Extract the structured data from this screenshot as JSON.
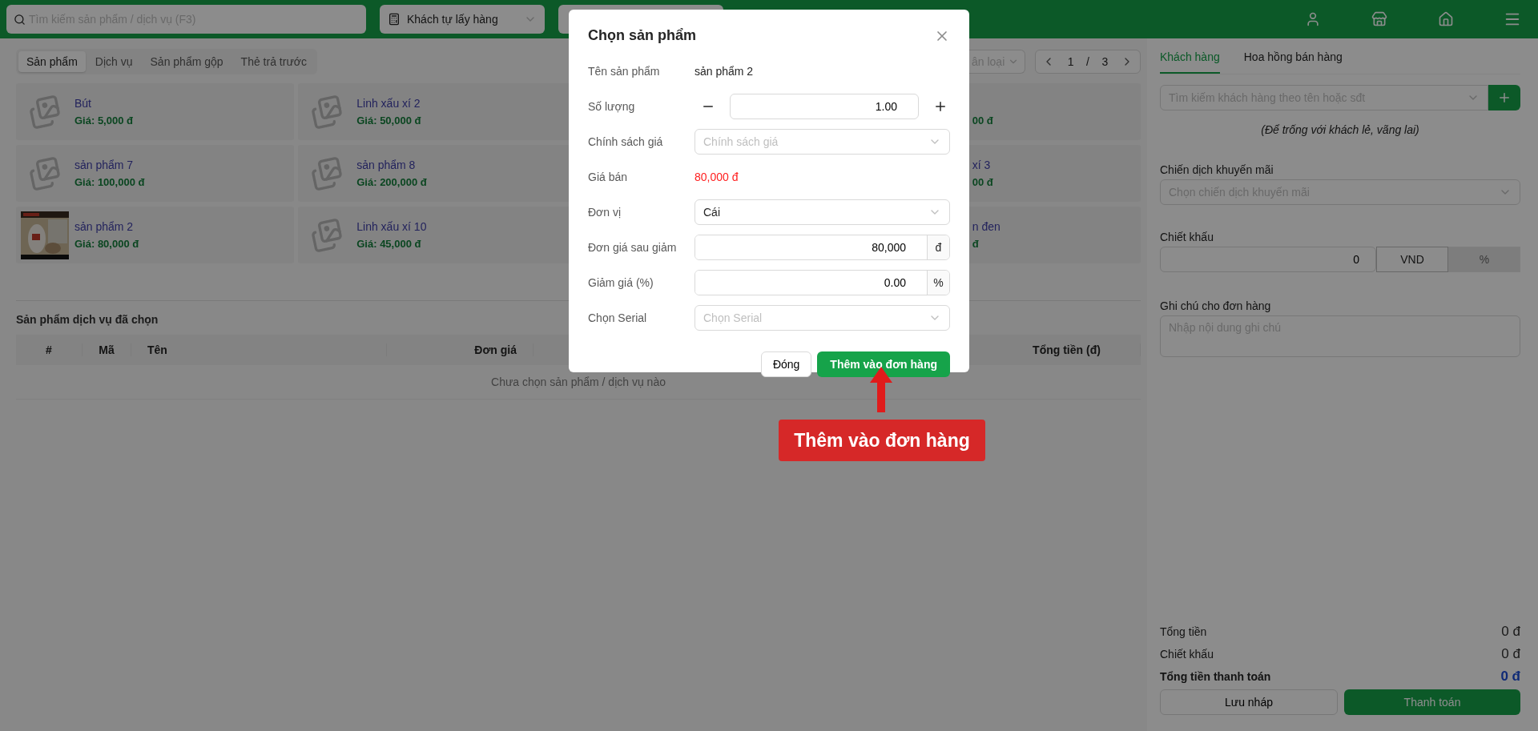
{
  "top_bar": {
    "search": {
      "placeholder": "Tìm kiếm sản phẩm / dịch vụ (F3)"
    },
    "delivery_select": {
      "value": "Khách tự lấy hàng"
    }
  },
  "category_tabs": [
    {
      "label": "Sản phẩm",
      "selected": true
    },
    {
      "label": "Dịch vụ",
      "selected": false
    },
    {
      "label": "Sản phẩm gộp",
      "selected": false
    },
    {
      "label": "Thẻ trả trước",
      "selected": false
    }
  ],
  "filters": {
    "category_select": {
      "placeholder": "ân loại"
    },
    "pagination": {
      "current": "1",
      "separator": "/",
      "total": "3"
    }
  },
  "products": [
    {
      "kind": "card",
      "name": "Bút",
      "price": "Giá: 5,000 đ"
    },
    {
      "kind": "card",
      "name": "Linh xấu xí 2",
      "price": "Giá: 50,000 đ"
    },
    {
      "kind": "cut",
      "price": "00 đ"
    },
    {
      "kind": "card",
      "name": "sản phẩm 7",
      "price": "Giá: 100,000 đ"
    },
    {
      "kind": "card",
      "name": "sản phẩm 8",
      "price": "Giá: 200,000 đ"
    },
    {
      "kind": "cut",
      "name": "xí 3",
      "price": "00 đ"
    },
    {
      "name": "sản phẩm 2",
      "price": "Giá: 80,000 đ"
    },
    {
      "kind": "card",
      "name": "Linh xấu xí 10",
      "price": "Giá: 45,000 đ"
    },
    {
      "kind": "cut",
      "name": "n đen",
      "price": "đ"
    }
  ],
  "selected_section": {
    "title": "Sản phẩm dịch vụ đã chọn",
    "columns": [
      {
        "label": "#"
      },
      {
        "label": "Mã"
      },
      {
        "label": "Tên"
      },
      {
        "label": "Đơn giá"
      },
      {
        "label": "Tổng tiền (đ)"
      }
    ],
    "empty_text": "Chưa chọn sản phẩm / dịch vụ nào"
  },
  "customer_panel": {
    "tabs": [
      {
        "label": "Khách hàng",
        "selected": true
      },
      {
        "label": "Hoa hồng bán hàng",
        "selected": false
      }
    ],
    "customer_search": {
      "placeholder": "Tìm kiếm khách hàng theo tên hoặc sđt"
    },
    "hint": "(Để trống với khách lẻ, vãng lai)",
    "promotion": {
      "label": "Chiến dịch khuyến mãi",
      "placeholder": "Chọn chiến dịch khuyến mãi"
    },
    "discount": {
      "label": "Chiết khấu",
      "value": "0",
      "units": [
        {
          "label": "VND",
          "selected": true
        },
        {
          "label": "%",
          "selected": false
        }
      ]
    },
    "note": {
      "label": "Ghi chú cho đơn hàng",
      "placeholder": "Nhập nội dung ghi chú"
    },
    "summary": [
      {
        "kind": "normal",
        "label": "Tổng tiền",
        "value": "0 đ"
      },
      {
        "kind": "normal",
        "label": "Chiết khấu",
        "value": "0 đ"
      },
      {
        "kind": "total",
        "label": "Tổng tiền thanh toán",
        "value": "0 đ"
      }
    ],
    "buttons": {
      "draft": "Lưu nháp",
      "pay": "Thanh toán"
    }
  },
  "modal": {
    "title": "Chọn sản phẩm",
    "rows": [
      {
        "kind": "text",
        "label": "Tên sản phẩm",
        "value": "sản phẩm 2"
      },
      {
        "kind": "stepper",
        "label": "Số lượng",
        "value": "1.00"
      },
      {
        "kind": "select",
        "label": "Chính sách giá",
        "placeholder": "Chính sách giá"
      },
      {
        "kind": "price",
        "label": "Giá bán",
        "value": "80,000 đ"
      },
      {
        "kind": "select",
        "label": "Đơn vị",
        "value": "Cái"
      },
      {
        "kind": "suffix",
        "label": "Đơn giá sau giảm",
        "value": "80,000",
        "suffix": "đ"
      },
      {
        "kind": "suffix",
        "label": "Giảm giá (%)",
        "value": "0.00",
        "suffix": "%"
      },
      {
        "kind": "select",
        "label": "Chọn Serial",
        "placeholder": "Chọn Serial"
      }
    ],
    "buttons": {
      "close": "Đóng",
      "add": "Thêm vào đơn hàng"
    }
  },
  "callout": {
    "text": "Thêm vào đơn hàng"
  }
}
